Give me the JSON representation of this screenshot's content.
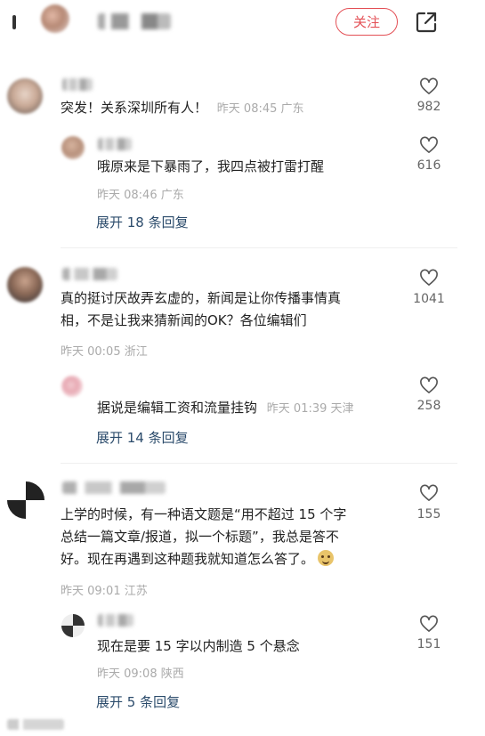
{
  "header": {
    "follow_label": "关注"
  },
  "comments": [
    {
      "text": "突发！关系深圳所有人！",
      "meta": "昨天 08:45 广东",
      "likes": "982",
      "reply": {
        "text": "哦原来是下暴雨了，我四点被打雷打醒",
        "meta": "昨天 08:46 广东",
        "likes": "616"
      },
      "expand": "展开 18 条回复"
    },
    {
      "text_lines": [
        "真的挺讨厌故弄玄虚的，新闻是让你传播事情真",
        "相，不是让我来猜新闻的OK？各位编辑们"
      ],
      "meta": "昨天 00:05 浙江",
      "likes": "1041",
      "reply": {
        "text": "据说是编辑工资和流量挂钩",
        "meta": "昨天 01:39 天津",
        "likes": "258"
      },
      "expand": "展开 14 条回复"
    },
    {
      "text_lines": [
        "上学的时候，有一种语文题是“用不超过 15 个字",
        "总结一篇文章/报道，拟一个标题”，我总是答不",
        "好。现在再遇到这种题我就知道怎么答了。"
      ],
      "meta": "昨天 09:01 江苏",
      "likes": "155",
      "reply": {
        "text": "现在是要 15 字以内制造 5 个悬念",
        "meta": "昨天 09:08 陕西",
        "likes": "151"
      },
      "expand": "展开 5 条回复"
    }
  ],
  "icons": {
    "back": "back-icon",
    "share": "share-icon",
    "like": "heart-outline-icon",
    "emoji": "grin-emoji-icon"
  },
  "colors": {
    "accent": "#e34f55",
    "expand_link": "#2c4c6c",
    "meta": "#aaaaaa"
  }
}
